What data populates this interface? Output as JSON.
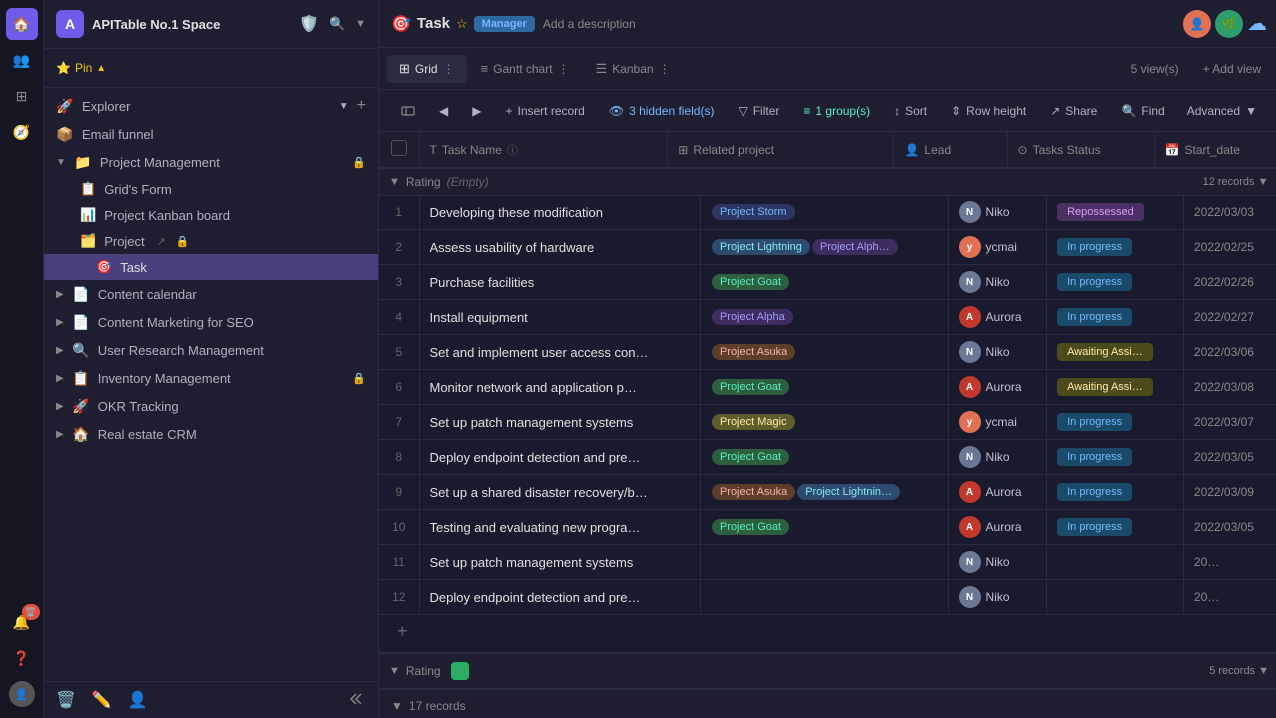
{
  "app": {
    "space_name": "APITable No.1 Space",
    "user_initial": "A"
  },
  "sidebar": {
    "pin_label": "Pin",
    "explorer_label": "Explorer",
    "items": [
      {
        "id": "email-funnel",
        "icon": "📦",
        "label": "Email funnel",
        "indent": 0
      },
      {
        "id": "project-management",
        "icon": "📁",
        "label": "Project Management",
        "indent": 0,
        "lock": true
      },
      {
        "id": "grids-form",
        "icon": "📋",
        "label": "Grid's Form",
        "indent": 1
      },
      {
        "id": "project-kanban",
        "icon": "📊",
        "label": "Project Kanban board",
        "indent": 1
      },
      {
        "id": "project",
        "icon": "🗂️",
        "label": "Project",
        "indent": 1,
        "share": true,
        "lock": true
      },
      {
        "id": "task",
        "icon": "🎯",
        "label": "Task",
        "indent": 2,
        "active": true
      },
      {
        "id": "content-calendar",
        "icon": "📄",
        "label": "Content calendar",
        "indent": 0
      },
      {
        "id": "content-marketing",
        "icon": "📄",
        "label": "Content Marketing for SEO",
        "indent": 0
      },
      {
        "id": "user-research",
        "icon": "🔍",
        "label": "User Research Management",
        "indent": 0
      },
      {
        "id": "inventory",
        "icon": "📋",
        "label": "Inventory Management",
        "indent": 0,
        "lock": true
      },
      {
        "id": "okr-tracking",
        "icon": "🚀",
        "label": "OKR Tracking",
        "indent": 0
      },
      {
        "id": "real-estate",
        "icon": "🏠",
        "label": "Real estate CRM",
        "indent": 0
      }
    ]
  },
  "task_view": {
    "title": "Task",
    "star": "☆",
    "tag": "Manager",
    "description": "Add a description"
  },
  "views": [
    {
      "id": "grid",
      "icon": "⊞",
      "label": "Grid",
      "active": true
    },
    {
      "id": "gantt",
      "icon": "≡",
      "label": "Gantt chart"
    },
    {
      "id": "kanban",
      "icon": "☰",
      "label": "Kanban"
    }
  ],
  "views_count": "5 view(s)",
  "add_view_label": "+ Add view",
  "toolbar": {
    "insert_record": "Insert record",
    "hidden_fields": "3 hidden field(s)",
    "filter": "Filter",
    "group": "1 group(s)",
    "sort": "Sort",
    "row_height": "Row height",
    "share": "Share",
    "find": "Find",
    "advanced": "Advanced"
  },
  "columns": [
    {
      "id": "task-name",
      "icon": "T",
      "label": "Task Name",
      "info": true
    },
    {
      "id": "related-project",
      "icon": "⊞",
      "label": "Related project"
    },
    {
      "id": "lead",
      "icon": "👤",
      "label": "Lead"
    },
    {
      "id": "tasks-status",
      "icon": "⊙",
      "label": "Tasks Status"
    },
    {
      "id": "start-date",
      "icon": "📅",
      "label": "Start_date"
    }
  ],
  "group1": {
    "label": "Rating",
    "sublabel": "(Empty)",
    "count": "12 records",
    "expanded": true
  },
  "rows": [
    {
      "num": 1,
      "task": "Developing these modification",
      "projects": [
        {
          "name": "Project Storm",
          "cls": "tag-storm"
        }
      ],
      "lead": "Niko",
      "lead_cls": "avatar-niko",
      "status": "Repossessed",
      "status_cls": "status-repossessed",
      "date": "2022/03/03"
    },
    {
      "num": 2,
      "task": "Assess usability of hardware",
      "projects": [
        {
          "name": "Project Lightning",
          "cls": "tag-lightning"
        },
        {
          "name": "Project Alph…",
          "cls": "tag-alpha"
        }
      ],
      "lead": "ycmai",
      "lead_cls": "avatar-ycmai",
      "status": "In progress",
      "status_cls": "status-in-progress",
      "date": "2022/02/25"
    },
    {
      "num": 3,
      "task": "Purchase facilities",
      "projects": [
        {
          "name": "Project Goat",
          "cls": "tag-goat"
        }
      ],
      "lead": "Niko",
      "lead_cls": "avatar-niko",
      "status": "In progress",
      "status_cls": "status-in-progress",
      "date": "2022/02/26"
    },
    {
      "num": 4,
      "task": "Install equipment",
      "projects": [
        {
          "name": "Project Alpha",
          "cls": "tag-alpha"
        }
      ],
      "lead": "Aurora",
      "lead_cls": "avatar-aurora",
      "status": "In progress",
      "status_cls": "status-in-progress",
      "date": "2022/02/27"
    },
    {
      "num": 5,
      "task": "Set and implement user access con…",
      "projects": [
        {
          "name": "Project Asuka",
          "cls": "tag-asuka"
        }
      ],
      "lead": "Niko",
      "lead_cls": "avatar-niko",
      "status": "Awaiting Assi…",
      "status_cls": "status-awaiting",
      "date": "2022/03/06"
    },
    {
      "num": 6,
      "task": "Monitor network and application p…",
      "projects": [
        {
          "name": "Project Goat",
          "cls": "tag-goat"
        }
      ],
      "lead": "Aurora",
      "lead_cls": "avatar-aurora",
      "status": "Awaiting Assi…",
      "status_cls": "status-awaiting",
      "date": "2022/03/08"
    },
    {
      "num": 7,
      "task": "Set up patch management systems",
      "projects": [
        {
          "name": "Project Magic",
          "cls": "tag-magic"
        }
      ],
      "lead": "ycmai",
      "lead_cls": "avatar-ycmai",
      "status": "In progress",
      "status_cls": "status-in-progress",
      "date": "2022/03/07"
    },
    {
      "num": 8,
      "task": "Deploy endpoint detection and pre…",
      "projects": [
        {
          "name": "Project Goat",
          "cls": "tag-goat"
        }
      ],
      "lead": "Niko",
      "lead_cls": "avatar-niko",
      "status": "In progress",
      "status_cls": "status-in-progress",
      "date": "2022/03/05"
    },
    {
      "num": 9,
      "task": "Set up a shared disaster recovery/b…",
      "projects": [
        {
          "name": "Project Asuka",
          "cls": "tag-asuka"
        },
        {
          "name": "Project Lightnin…",
          "cls": "tag-lightning"
        }
      ],
      "lead": "Aurora",
      "lead_cls": "avatar-aurora",
      "status": "In progress",
      "status_cls": "status-in-progress",
      "date": "2022/03/09"
    },
    {
      "num": 10,
      "task": "Testing and evaluating new progra…",
      "projects": [
        {
          "name": "Project Goat",
          "cls": "tag-goat"
        }
      ],
      "lead": "Aurora",
      "lead_cls": "avatar-aurora",
      "status": "In progress",
      "status_cls": "status-in-progress",
      "date": "2022/03/05"
    },
    {
      "num": 11,
      "task": "Set up patch management systems",
      "projects": [],
      "lead": "Niko",
      "lead_cls": "avatar-niko",
      "status": "",
      "status_cls": "",
      "date": "20…"
    },
    {
      "num": 12,
      "task": "Deploy endpoint detection and pre…",
      "projects": [],
      "lead": "Niko",
      "lead_cls": "avatar-niko",
      "status": "",
      "status_cls": "",
      "date": "20…"
    }
  ],
  "group2": {
    "label": "Rating",
    "icon": "✅",
    "count": "5 records",
    "expanded": true
  },
  "total_records": "17 records",
  "footer_icons": [
    "🗑️",
    "✏️",
    "👤"
  ]
}
